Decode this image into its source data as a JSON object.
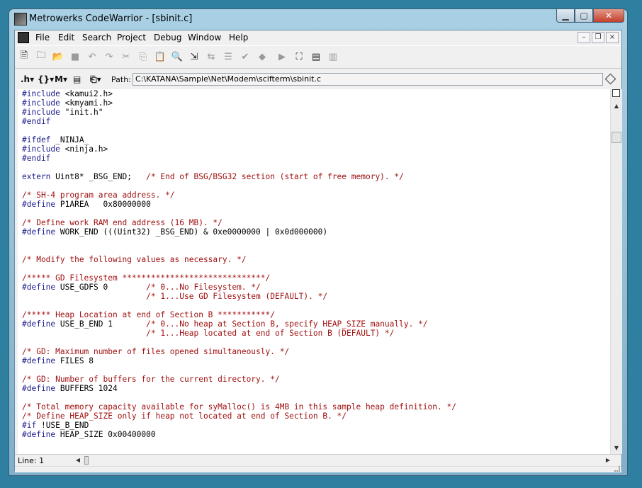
{
  "window": {
    "title": "Metrowerks CodeWarrior - [sbinit.c]"
  },
  "menubar": {
    "items": [
      "File",
      "Edit",
      "Search",
      "Project",
      "Debug",
      "Window",
      "Help"
    ]
  },
  "toolbar": {
    "icons": [
      "new-file-icon",
      "open-folder-icon",
      "open-icon",
      "save-icon",
      "undo-icon",
      "redo-icon",
      "cut-icon",
      "copy-icon",
      "paste-icon",
      "find-icon",
      "find-next-icon",
      "replace-icon",
      "list-icon",
      "check-syntax-icon",
      "preprocess-icon",
      "run-icon",
      "make-icon",
      "compile-icon",
      "disassemble-icon"
    ]
  },
  "pathbar": {
    "label": "Path:",
    "path": "C:\\KATANA\\Sample\\Net\\Modem\\scifterm\\sbinit.c"
  },
  "editor": {
    "lines": [
      [
        [
          "pp",
          "#include"
        ],
        [
          "code",
          " <kamui2.h>"
        ]
      ],
      [
        [
          "pp",
          "#include"
        ],
        [
          "code",
          " <kmyami.h>"
        ]
      ],
      [
        [
          "pp",
          "#include"
        ],
        [
          "code",
          " \"init.h\""
        ]
      ],
      [
        [
          "pp",
          "#endif"
        ]
      ],
      [],
      [
        [
          "pp",
          "#ifdef"
        ],
        [
          "code",
          " _NINJA_"
        ]
      ],
      [
        [
          "pp",
          "#include"
        ],
        [
          "code",
          " <ninja.h>"
        ]
      ],
      [
        [
          "pp",
          "#endif"
        ]
      ],
      [],
      [
        [
          "pp",
          "extern"
        ],
        [
          "code",
          " Uint8* _BSG_END;   "
        ],
        [
          "comment",
          "/* End of BSG/BSG32 section (start of free memory). */"
        ]
      ],
      [],
      [
        [
          "comment",
          "/* SH-4 program area address. */"
        ]
      ],
      [
        [
          "pp",
          "#define"
        ],
        [
          "code",
          " P1AREA   0x80000000"
        ]
      ],
      [],
      [
        [
          "comment",
          "/* Define work RAM end address (16 MB). */"
        ]
      ],
      [
        [
          "pp",
          "#define"
        ],
        [
          "code",
          " WORK_END (((Uint32) _BSG_END) & 0xe0000000 | 0x0d000000)"
        ]
      ],
      [],
      [],
      [
        [
          "comment",
          "/* Modify the following values as necessary. */"
        ]
      ],
      [],
      [
        [
          "comment",
          "/***** GD Filesystem ******************************/"
        ]
      ],
      [
        [
          "pp",
          "#define"
        ],
        [
          "code",
          " USE_GDFS 0        "
        ],
        [
          "comment",
          "/* 0...No Filesystem. */"
        ]
      ],
      [
        [
          "code",
          "                          "
        ],
        [
          "comment",
          "/* 1...Use GD Filesystem (DEFAULT). */"
        ]
      ],
      [],
      [
        [
          "comment",
          "/***** Heap Location at end of Section B ***********/"
        ]
      ],
      [
        [
          "pp",
          "#define"
        ],
        [
          "code",
          " USE_B_END 1       "
        ],
        [
          "comment",
          "/* 0...No heap at Section B, specify HEAP_SIZE manually. */"
        ]
      ],
      [
        [
          "code",
          "                          "
        ],
        [
          "comment",
          "/* 1...Heap located at end of Section B (DEFAULT) */"
        ]
      ],
      [],
      [
        [
          "comment",
          "/* GD: Maximum number of files opened simultaneously. */"
        ]
      ],
      [
        [
          "pp",
          "#define"
        ],
        [
          "code",
          " FILES 8"
        ]
      ],
      [],
      [
        [
          "comment",
          "/* GD: Number of buffers for the current directory. */"
        ]
      ],
      [
        [
          "pp",
          "#define"
        ],
        [
          "code",
          " BUFFERS 1024"
        ]
      ],
      [],
      [
        [
          "comment",
          "/* Total memory capacity available for syMalloc() is 4MB in this sample heap definition. */"
        ]
      ],
      [
        [
          "comment",
          "/* Define HEAP_SIZE only if heap not located at end of Section B. */"
        ]
      ],
      [
        [
          "pp",
          "#if"
        ],
        [
          "code",
          " !USE_B_END"
        ]
      ],
      [
        [
          "pp",
          "#define"
        ],
        [
          "code",
          " HEAP_SIZE 0x00400000"
        ]
      ]
    ]
  },
  "status": {
    "line": "Line: 1"
  }
}
